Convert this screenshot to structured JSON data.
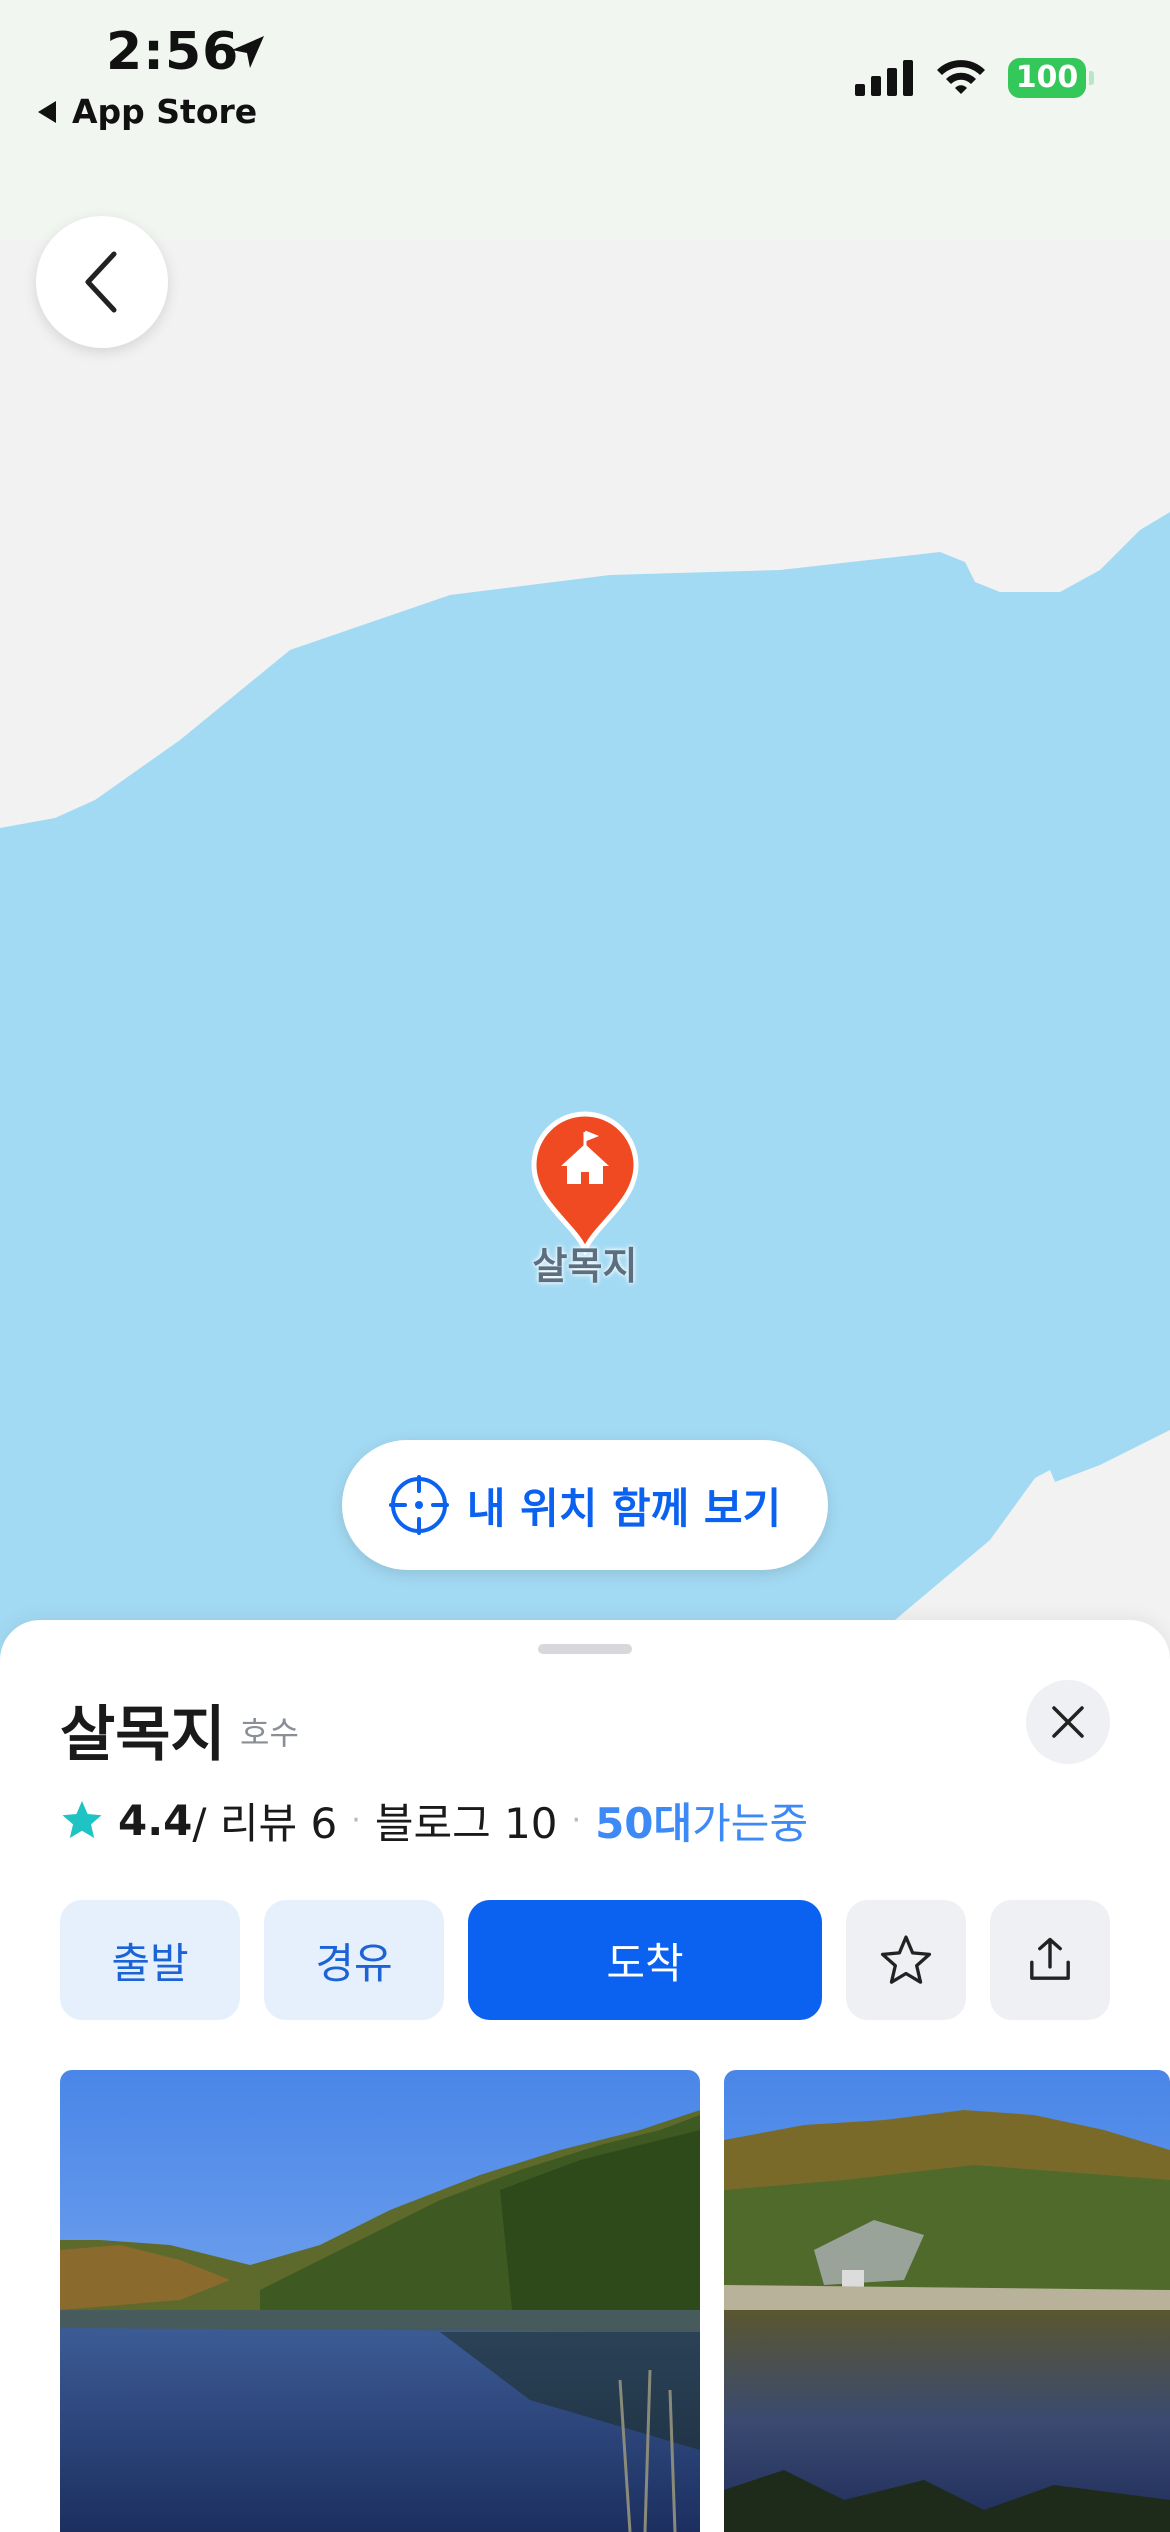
{
  "status_bar": {
    "time": "2:56",
    "back_app": "App Store",
    "battery": "100"
  },
  "map": {
    "pin_label": "살목지",
    "my_location_label": "내 위치 함께 보기",
    "colors": {
      "water": "#a3daf3",
      "land": "#f2f2f2",
      "pin": "#f04a23"
    }
  },
  "sheet": {
    "title": "살목지",
    "category": "호수",
    "rating": "4.4",
    "reviews": "/ 리뷰 6",
    "blogs": "블로그 10",
    "visitors_num": "50대",
    "visitors_txt": " 가는중",
    "actions": {
      "depart": "출발",
      "via": "경유",
      "arrive": "도착"
    }
  }
}
